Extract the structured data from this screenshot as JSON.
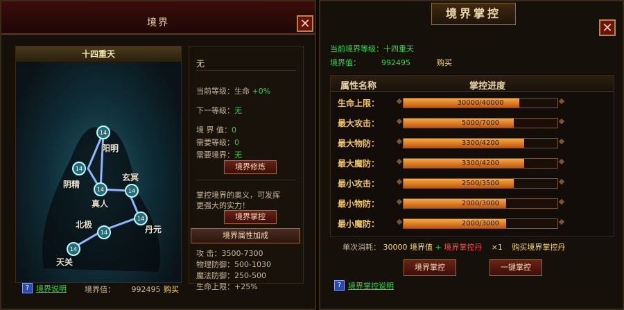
{
  "left": {
    "title": "境界",
    "map_header": "十四重天",
    "node_badge": "14",
    "nodes": [
      "阳明",
      "阴精",
      "玄冥",
      "真人",
      "北极",
      "丹元",
      "天关"
    ],
    "stage_name": "无",
    "current_level": "当前等级：生命",
    "current_level_value": "+0%",
    "next_level_label": "下一等级：",
    "next_level_value": "无",
    "realm_value_label": "境 界 值：",
    "realm_value_value": "0",
    "need_level_label": "需要等级：",
    "need_level_value": "0",
    "need_realm_label": "需要境界：",
    "need_realm_value": "无",
    "train_button": "境界修炼",
    "desc_line1": "掌控境界的奥义，可发挥",
    "desc_line2": "更强大的实力！",
    "control_button": "境界掌控",
    "attr_bonus_button": "境界属性加成",
    "attrs": [
      {
        "label": "攻      击：",
        "value": "3500-7300"
      },
      {
        "label": "物理防御：",
        "value": "500-1030"
      },
      {
        "label": "魔法防御：",
        "value": "250-500"
      },
      {
        "label": "生命上限：",
        "value": "+25%"
      }
    ],
    "help_mark": "?",
    "help_link": "境界说明",
    "footer_realm_label": "境界值：",
    "footer_realm_value": "992495",
    "buy": "购买",
    "close": "✕"
  },
  "right": {
    "title": "境界掌控",
    "current_realm": "当前境界等级：十四重天",
    "realm_value_label": "境界值：",
    "realm_value": "992495",
    "buy": "购买",
    "col_name": "属性名称",
    "col_progress": "掌控进度",
    "rows": [
      {
        "label": "生命上限：",
        "text": "30000/40000",
        "progress": 0.75
      },
      {
        "label": "最大攻击：",
        "text": "5000/7000",
        "progress": 0.714
      },
      {
        "label": "最大物防：",
        "text": "3300/4200",
        "progress": 0.786
      },
      {
        "label": "最大魔防：",
        "text": "3300/4200",
        "progress": 0.786
      },
      {
        "label": "最小攻击：",
        "text": "2500/3500",
        "progress": 0.714
      },
      {
        "label": "最小物防：",
        "text": "2000/3000",
        "progress": 0.667
      },
      {
        "label": "最小魔防：",
        "text": "2000/3000",
        "progress": 0.667
      }
    ],
    "cost_label": "单次消耗：",
    "cost_amount": "30000",
    "cost_realm": "境界值",
    "cost_plus": "+",
    "cost_item": "境界掌控丹",
    "cost_count": "×1",
    "cost_buy": "购买境界掌控丹",
    "control_button": "境界掌控",
    "one_key_button": "一键掌控",
    "help_mark": "?",
    "help_link": "境界掌控说明",
    "close": "✕"
  }
}
